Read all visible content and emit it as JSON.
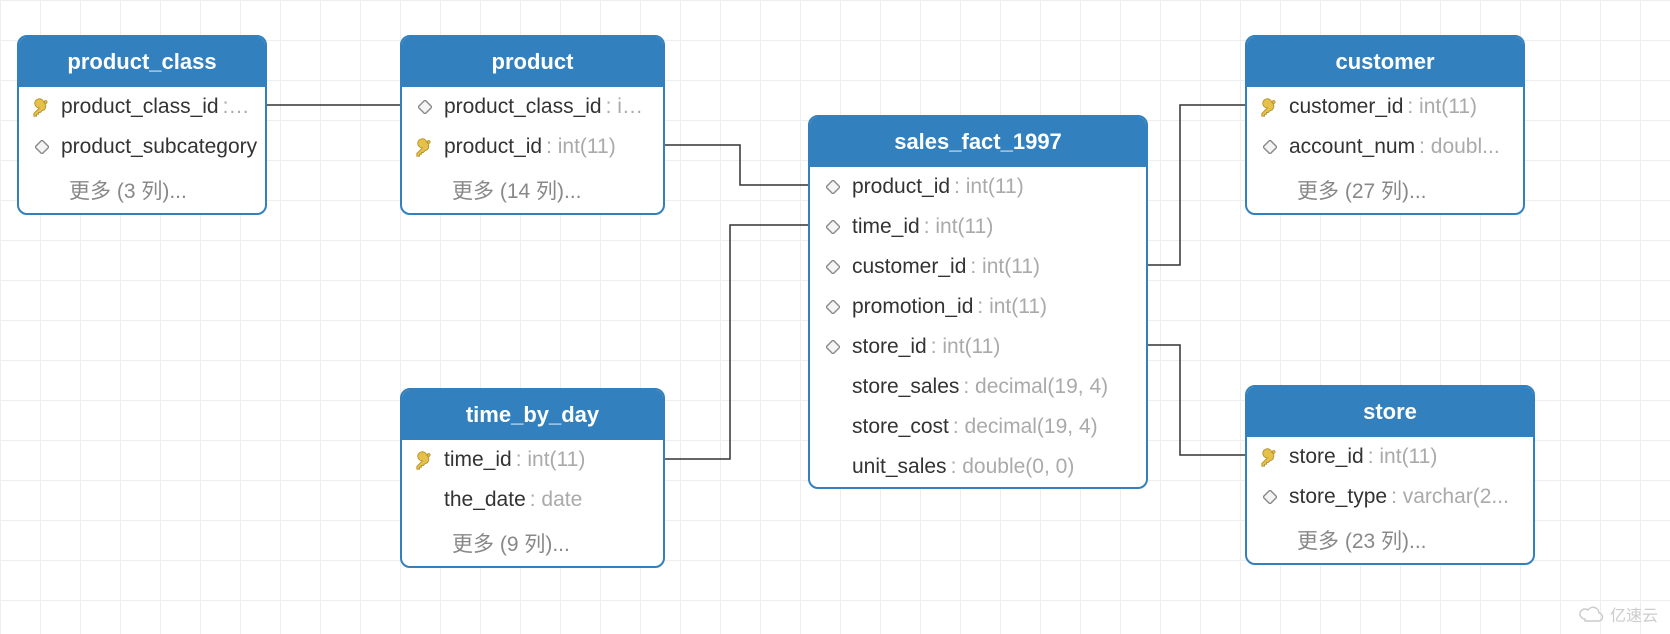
{
  "tables": {
    "product_class": {
      "title": "product_class",
      "rows": [
        {
          "icon": "key",
          "name": "product_class_id",
          "type": ": i..."
        },
        {
          "icon": "diamond",
          "name": "product_subcategory",
          "type": "..."
        }
      ],
      "more": "更多 (3 列)..."
    },
    "product": {
      "title": "product",
      "rows": [
        {
          "icon": "diamond",
          "name": "product_class_id",
          "type": ": int..."
        },
        {
          "icon": "key",
          "name": "product_id",
          "type": ": int(11)"
        }
      ],
      "more": "更多 (14 列)..."
    },
    "time_by_day": {
      "title": "time_by_day",
      "rows": [
        {
          "icon": "key",
          "name": "time_id",
          "type": ": int(11)"
        },
        {
          "icon": "none",
          "name": "the_date",
          "type": ": date"
        }
      ],
      "more": "更多 (9 列)..."
    },
    "sales_fact_1997": {
      "title": "sales_fact_1997",
      "rows": [
        {
          "icon": "diamond",
          "name": "product_id",
          "type": ": int(11)"
        },
        {
          "icon": "diamond",
          "name": "time_id",
          "type": ": int(11)"
        },
        {
          "icon": "diamond",
          "name": "customer_id",
          "type": ": int(11)"
        },
        {
          "icon": "diamond",
          "name": "promotion_id",
          "type": ": int(11)"
        },
        {
          "icon": "diamond",
          "name": "store_id",
          "type": ": int(11)"
        },
        {
          "icon": "none",
          "name": "store_sales",
          "type": ": decimal(19, 4)"
        },
        {
          "icon": "none",
          "name": "store_cost",
          "type": ": decimal(19, 4)"
        },
        {
          "icon": "none",
          "name": "unit_sales",
          "type": ": double(0, 0)"
        }
      ]
    },
    "customer": {
      "title": "customer",
      "rows": [
        {
          "icon": "key",
          "name": "customer_id",
          "type": ": int(11)"
        },
        {
          "icon": "diamond",
          "name": "account_num",
          "type": ": doubl..."
        }
      ],
      "more": "更多 (27 列)..."
    },
    "store": {
      "title": "store",
      "rows": [
        {
          "icon": "key",
          "name": "store_id",
          "type": ": int(11)"
        },
        {
          "icon": "diamond",
          "name": "store_type",
          "type": ": varchar(2..."
        }
      ],
      "more": "更多 (23 列)..."
    }
  },
  "watermark": "亿速云"
}
